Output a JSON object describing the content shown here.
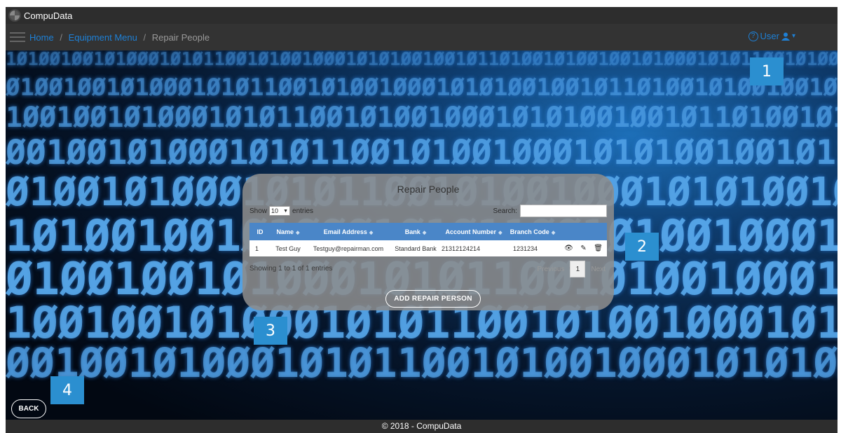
{
  "app": {
    "title": "CompuData"
  },
  "breadcrumb": {
    "home": "Home",
    "sep1": "/",
    "equipment": "Equipment Menu",
    "sep2": "/",
    "current": "Repair People"
  },
  "user_menu": {
    "help_icon": "?",
    "label": "User",
    "user_icon": "user-icon",
    "caret": "▾"
  },
  "callouts": [
    "1",
    "2",
    "3",
    "4"
  ],
  "panel": {
    "title": "Repair People",
    "show_label": "Show",
    "entries_value": "10",
    "entries_label": "entries",
    "search_label": "Search:",
    "search_value": "",
    "columns": [
      "ID",
      "Name",
      "Email Address",
      "Bank",
      "Account Number",
      "Branch Code"
    ],
    "rows": [
      {
        "id": "1",
        "name": "Test Guy",
        "email": "Testguy@repairman.com",
        "bank": "Standard Bank",
        "account": "21312124214",
        "branch": "1231234"
      }
    ],
    "row_actions": {
      "view_icon": "eye-icon",
      "edit_icon": "pencil-icon",
      "delete_icon": "trash-icon"
    },
    "info": "Showing 1 to 1 of 1 entries",
    "pager": {
      "previous": "Previous",
      "page": "1",
      "next": "Next"
    },
    "add_button": "ADD REPAIR PERSON"
  },
  "back_button": "BACK",
  "footer": "© 2018 - CompuData",
  "colors": {
    "accent": "#1e80d6",
    "table_header": "#4a86c8",
    "callout": "#2b8fd0",
    "bar": "#2d2d2d"
  }
}
